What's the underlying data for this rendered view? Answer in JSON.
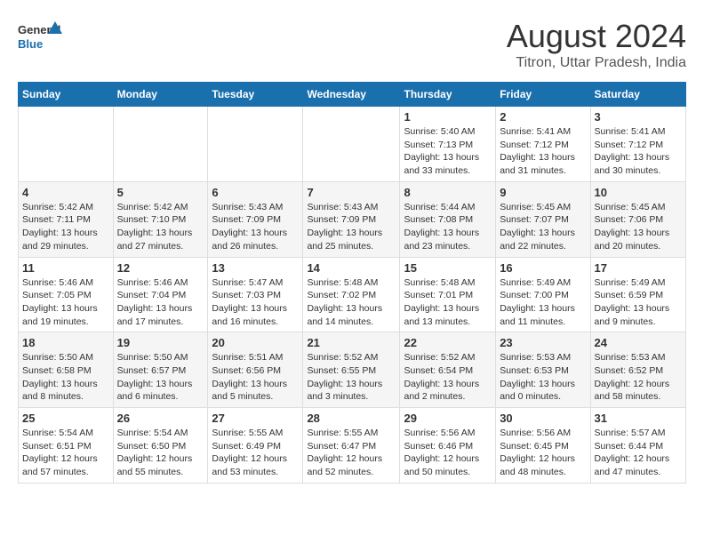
{
  "logo": {
    "line1": "General",
    "line2": "Blue"
  },
  "title": "August 2024",
  "location": "Titron, Uttar Pradesh, India",
  "weekdays": [
    "Sunday",
    "Monday",
    "Tuesday",
    "Wednesday",
    "Thursday",
    "Friday",
    "Saturday"
  ],
  "weeks": [
    [
      {
        "day": "",
        "info": ""
      },
      {
        "day": "",
        "info": ""
      },
      {
        "day": "",
        "info": ""
      },
      {
        "day": "",
        "info": ""
      },
      {
        "day": "1",
        "info": "Sunrise: 5:40 AM\nSunset: 7:13 PM\nDaylight: 13 hours\nand 33 minutes."
      },
      {
        "day": "2",
        "info": "Sunrise: 5:41 AM\nSunset: 7:12 PM\nDaylight: 13 hours\nand 31 minutes."
      },
      {
        "day": "3",
        "info": "Sunrise: 5:41 AM\nSunset: 7:12 PM\nDaylight: 13 hours\nand 30 minutes."
      }
    ],
    [
      {
        "day": "4",
        "info": "Sunrise: 5:42 AM\nSunset: 7:11 PM\nDaylight: 13 hours\nand 29 minutes."
      },
      {
        "day": "5",
        "info": "Sunrise: 5:42 AM\nSunset: 7:10 PM\nDaylight: 13 hours\nand 27 minutes."
      },
      {
        "day": "6",
        "info": "Sunrise: 5:43 AM\nSunset: 7:09 PM\nDaylight: 13 hours\nand 26 minutes."
      },
      {
        "day": "7",
        "info": "Sunrise: 5:43 AM\nSunset: 7:09 PM\nDaylight: 13 hours\nand 25 minutes."
      },
      {
        "day": "8",
        "info": "Sunrise: 5:44 AM\nSunset: 7:08 PM\nDaylight: 13 hours\nand 23 minutes."
      },
      {
        "day": "9",
        "info": "Sunrise: 5:45 AM\nSunset: 7:07 PM\nDaylight: 13 hours\nand 22 minutes."
      },
      {
        "day": "10",
        "info": "Sunrise: 5:45 AM\nSunset: 7:06 PM\nDaylight: 13 hours\nand 20 minutes."
      }
    ],
    [
      {
        "day": "11",
        "info": "Sunrise: 5:46 AM\nSunset: 7:05 PM\nDaylight: 13 hours\nand 19 minutes."
      },
      {
        "day": "12",
        "info": "Sunrise: 5:46 AM\nSunset: 7:04 PM\nDaylight: 13 hours\nand 17 minutes."
      },
      {
        "day": "13",
        "info": "Sunrise: 5:47 AM\nSunset: 7:03 PM\nDaylight: 13 hours\nand 16 minutes."
      },
      {
        "day": "14",
        "info": "Sunrise: 5:48 AM\nSunset: 7:02 PM\nDaylight: 13 hours\nand 14 minutes."
      },
      {
        "day": "15",
        "info": "Sunrise: 5:48 AM\nSunset: 7:01 PM\nDaylight: 13 hours\nand 13 minutes."
      },
      {
        "day": "16",
        "info": "Sunrise: 5:49 AM\nSunset: 7:00 PM\nDaylight: 13 hours\nand 11 minutes."
      },
      {
        "day": "17",
        "info": "Sunrise: 5:49 AM\nSunset: 6:59 PM\nDaylight: 13 hours\nand 9 minutes."
      }
    ],
    [
      {
        "day": "18",
        "info": "Sunrise: 5:50 AM\nSunset: 6:58 PM\nDaylight: 13 hours\nand 8 minutes."
      },
      {
        "day": "19",
        "info": "Sunrise: 5:50 AM\nSunset: 6:57 PM\nDaylight: 13 hours\nand 6 minutes."
      },
      {
        "day": "20",
        "info": "Sunrise: 5:51 AM\nSunset: 6:56 PM\nDaylight: 13 hours\nand 5 minutes."
      },
      {
        "day": "21",
        "info": "Sunrise: 5:52 AM\nSunset: 6:55 PM\nDaylight: 13 hours\nand 3 minutes."
      },
      {
        "day": "22",
        "info": "Sunrise: 5:52 AM\nSunset: 6:54 PM\nDaylight: 13 hours\nand 2 minutes."
      },
      {
        "day": "23",
        "info": "Sunrise: 5:53 AM\nSunset: 6:53 PM\nDaylight: 13 hours\nand 0 minutes."
      },
      {
        "day": "24",
        "info": "Sunrise: 5:53 AM\nSunset: 6:52 PM\nDaylight: 12 hours\nand 58 minutes."
      }
    ],
    [
      {
        "day": "25",
        "info": "Sunrise: 5:54 AM\nSunset: 6:51 PM\nDaylight: 12 hours\nand 57 minutes."
      },
      {
        "day": "26",
        "info": "Sunrise: 5:54 AM\nSunset: 6:50 PM\nDaylight: 12 hours\nand 55 minutes."
      },
      {
        "day": "27",
        "info": "Sunrise: 5:55 AM\nSunset: 6:49 PM\nDaylight: 12 hours\nand 53 minutes."
      },
      {
        "day": "28",
        "info": "Sunrise: 5:55 AM\nSunset: 6:47 PM\nDaylight: 12 hours\nand 52 minutes."
      },
      {
        "day": "29",
        "info": "Sunrise: 5:56 AM\nSunset: 6:46 PM\nDaylight: 12 hours\nand 50 minutes."
      },
      {
        "day": "30",
        "info": "Sunrise: 5:56 AM\nSunset: 6:45 PM\nDaylight: 12 hours\nand 48 minutes."
      },
      {
        "day": "31",
        "info": "Sunrise: 5:57 AM\nSunset: 6:44 PM\nDaylight: 12 hours\nand 47 minutes."
      }
    ]
  ]
}
